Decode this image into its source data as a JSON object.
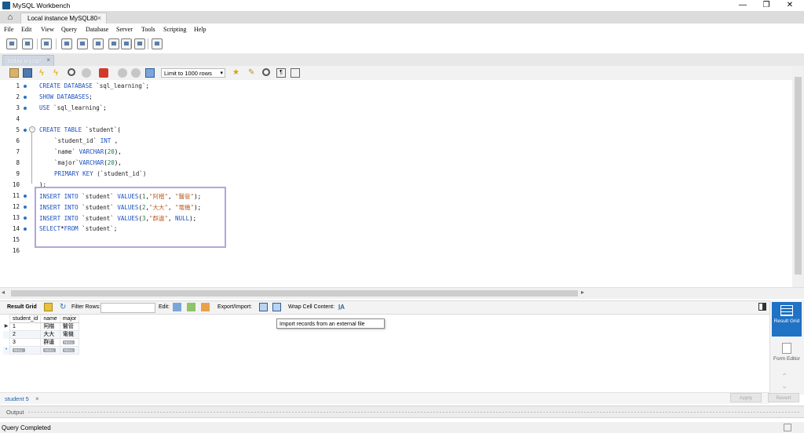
{
  "window": {
    "title": "MySQL Workbench",
    "controls": {
      "minimize": "—",
      "maximize": "❐",
      "close": "✕"
    }
  },
  "instance_tab": {
    "label": "Local instance MySQL80",
    "close": "×"
  },
  "menu": [
    "File",
    "Edit",
    "View",
    "Query",
    "Database",
    "Server",
    "Tools",
    "Scripting",
    "Help"
  ],
  "editor_tab": {
    "label": "30day mysql*",
    "close": "×"
  },
  "sql_toolbar": {
    "limit_label": "Limit to 1000 rows",
    "limit_arrow": "▾"
  },
  "editor": {
    "lines": [
      {
        "n": "1",
        "marker": true
      },
      {
        "n": "2",
        "marker": true
      },
      {
        "n": "3",
        "marker": true
      },
      {
        "n": "4",
        "marker": false
      },
      {
        "n": "5",
        "marker": true
      },
      {
        "n": "6",
        "marker": false
      },
      {
        "n": "7",
        "marker": false
      },
      {
        "n": "8",
        "marker": false
      },
      {
        "n": "9",
        "marker": false
      },
      {
        "n": "10",
        "marker": false
      },
      {
        "n": "11",
        "marker": true
      },
      {
        "n": "12",
        "marker": true
      },
      {
        "n": "13",
        "marker": true
      },
      {
        "n": "14",
        "marker": true
      },
      {
        "n": "15",
        "marker": false
      },
      {
        "n": "16",
        "marker": false
      }
    ],
    "code": {
      "l1": [
        "CREATE DATABASE ",
        "`sql_learning`",
        ";"
      ],
      "l2": [
        "SHOW DATABASES",
        ";"
      ],
      "l3": [
        "USE ",
        "`sql_learning`",
        ";"
      ],
      "l5": [
        "CREATE TABLE ",
        "`student`",
        "("
      ],
      "l6": [
        "`student_id` ",
        "INT",
        " ,"
      ],
      "l7": [
        "`name` ",
        "VARCHAR",
        "(",
        "20",
        "),"
      ],
      "l8": [
        "`major`",
        "VARCHAR",
        "(",
        "20",
        "),"
      ],
      "l9": [
        "PRIMARY KEY ",
        "(`student_id`)"
      ],
      "l10": [
        ");"
      ],
      "l11": [
        "INSERT INTO ",
        "`student` ",
        "VALUES",
        "(",
        "1",
        ",",
        "\"阿楷\"",
        ", ",
        "\"醫管\"",
        ");"
      ],
      "l12": [
        "INSERT INTO ",
        "`student` ",
        "VALUES",
        "(",
        "2",
        ",",
        "\"大大\"",
        ", ",
        "\"電機\"",
        ");"
      ],
      "l13": [
        "INSERT INTO ",
        "`student` ",
        "VALUES",
        "(",
        "3",
        ",",
        "\"群邊\"",
        ", ",
        "NULL",
        ");"
      ],
      "l14": [
        "SELECT",
        "*",
        "FROM ",
        "`student`",
        ";"
      ]
    }
  },
  "result_toolbar": {
    "result_grid": "Result Grid",
    "filter_rows": "Filter Rows:",
    "edit": "Edit:",
    "export_import": "Export/Import:",
    "wrap": "Wrap Cell Content:",
    "tooltip": "Import records from an external file"
  },
  "grid": {
    "columns": [
      "student_id",
      "name",
      "major"
    ],
    "rows": [
      {
        "indicator": "▶",
        "student_id": "1",
        "name": "阿楷",
        "major": "醫管"
      },
      {
        "indicator": "",
        "student_id": "2",
        "name": "大大",
        "major": "電機"
      },
      {
        "indicator": "",
        "student_id": "3",
        "name": "群邊",
        "major": "NULL"
      },
      {
        "indicator": "•",
        "student_id": "NULL",
        "name": "NULL",
        "major": "NULL"
      }
    ]
  },
  "side_panel": {
    "result_grid": "Result Grid",
    "form_editor": "Form Editor"
  },
  "result_tabs": {
    "tab": "student 5",
    "close": "×",
    "apply": "Apply",
    "revert": "Revert"
  },
  "output": {
    "label": "Output"
  },
  "status": {
    "text": "Query Completed"
  }
}
